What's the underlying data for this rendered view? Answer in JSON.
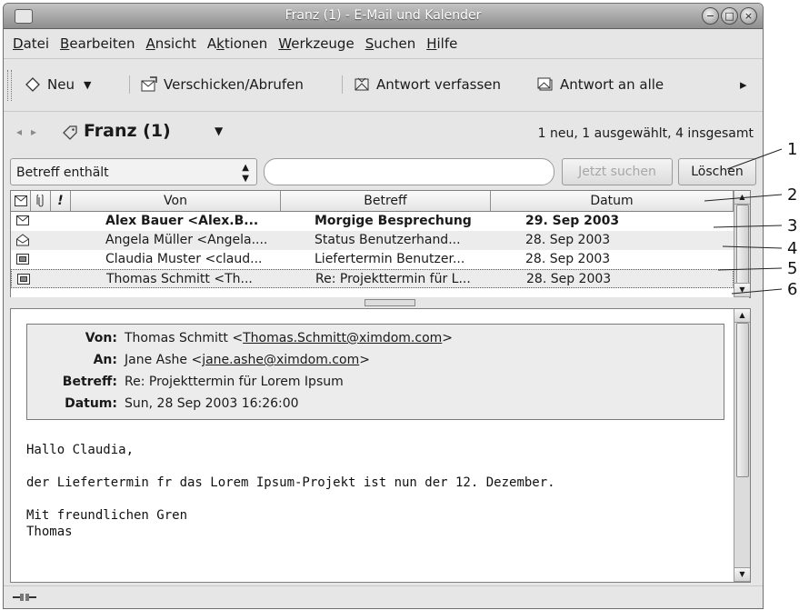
{
  "window": {
    "title": "Franz (1) - E-Mail und Kalender"
  },
  "menubar": [
    {
      "pre": "",
      "u": "D",
      "post": "atei"
    },
    {
      "pre": "",
      "u": "B",
      "post": "earbeiten"
    },
    {
      "pre": "",
      "u": "A",
      "post": "nsicht"
    },
    {
      "pre": "A",
      "u": "k",
      "post": "tionen"
    },
    {
      "pre": "",
      "u": "W",
      "post": "erkzeuge"
    },
    {
      "pre": "",
      "u": "S",
      "post": "uchen"
    },
    {
      "pre": "",
      "u": "H",
      "post": "ilfe"
    }
  ],
  "toolbar": {
    "new_label": "Neu",
    "send_receive_label": "Verschicken/Abrufen",
    "reply_label": "Antwort verfassen",
    "reply_all_label": "Antwort an alle",
    "overflow": "▸"
  },
  "folder": {
    "name": "Franz (1)",
    "status": "1 neu, 1 ausgewählt, 4 insgesamt"
  },
  "search": {
    "filter": "Betreff enthält",
    "query": "",
    "find_now_label": "Jetzt suchen",
    "clear_label": "Löschen"
  },
  "message_list": {
    "columns": [
      "Von",
      "Betreff",
      "Datum"
    ],
    "header_icons": [
      "envelope-icon",
      "paperclip-icon",
      "flag-icon"
    ],
    "rows": [
      {
        "from": "Alex Bauer <Alex.B...",
        "subject": "Morgige Besprechung",
        "date": "29. Sep 2003",
        "status": "unread",
        "icon": "envelope-closed-icon"
      },
      {
        "from": "Angela Müller <Angela....",
        "subject": "Status Benutzerhand...",
        "date": "28. Sep 2003",
        "status": "read",
        "icon": "envelope-open-icon"
      },
      {
        "from": "Claudia Muster <claud...",
        "subject": "Liefertermin Benutzer...",
        "date": "28. Sep 2003",
        "status": "replied",
        "icon": "envelope-replied-icon"
      },
      {
        "from": "Thomas Schmitt <Th...",
        "subject": "Re: Projekttermin für L...",
        "date": "28. Sep 2003",
        "status": "replied",
        "icon": "envelope-replied-icon"
      }
    ]
  },
  "preview": {
    "headers": [
      {
        "label": "Von:",
        "text": "Thomas Schmitt <",
        "link": "Thomas.Schmitt@ximdom.com",
        "suffix": ">"
      },
      {
        "label": "An:",
        "text": "Jane Ashe <",
        "link": "jane.ashe@ximdom.com",
        "suffix": ">"
      },
      {
        "label": "Betreff:",
        "text": "Re: Projekttermin für Lorem Ipsum",
        "link": "",
        "suffix": ""
      },
      {
        "label": "Datum:",
        "text": "Sun, 28 Sep 2003 16:26:00",
        "link": "",
        "suffix": ""
      }
    ],
    "body": "Hallo Claudia,\n\nder Liefertermin fr das Lorem Ipsum-Projekt ist nun der 12. Dezember.\n\nMit freundlichen Gren\nThomas"
  },
  "callouts": [
    "1",
    "2",
    "3",
    "4",
    "5",
    "6"
  ]
}
